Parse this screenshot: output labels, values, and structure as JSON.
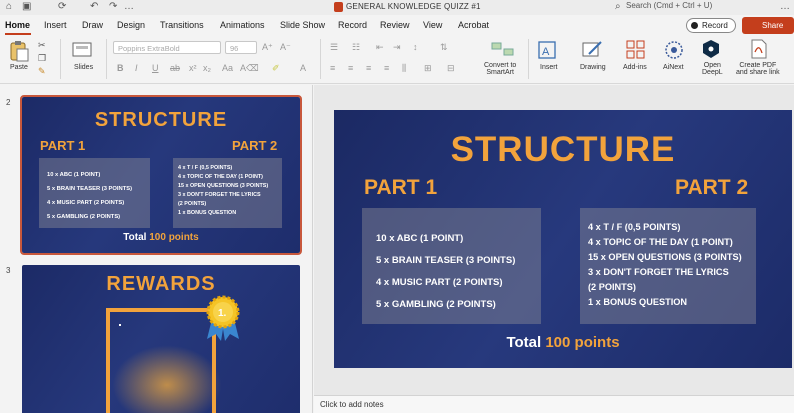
{
  "window": {
    "title": "GENERAL KNOWLEDGE QUIZZ #1",
    "search_placeholder": "Search (Cmd + Ctrl + U)"
  },
  "tabs": [
    "Home",
    "Insert",
    "Draw",
    "Design",
    "Transitions",
    "Animations",
    "Slide Show",
    "Record",
    "Review",
    "View",
    "Acrobat"
  ],
  "actions": {
    "record": "Record",
    "share": "Share"
  },
  "ribbon": {
    "paste": "Paste",
    "slides": "Slides",
    "font_name": "Poppins ExtraBold",
    "font_size": "96",
    "convert_smartart": [
      "Convert to",
      "SmartArt"
    ],
    "insert": "Insert",
    "drawing": "Drawing",
    "addins": "Add-ins",
    "ainext": "AiNext",
    "open_deepl": [
      "Open",
      "DeepL"
    ],
    "create_pdf": [
      "Create PDF",
      "and share link"
    ]
  },
  "thumbnails": {
    "slide2_number": "2",
    "slide3_number": "3",
    "slide3_title": "REWARDS",
    "medal_label": "1."
  },
  "slide": {
    "title": "STRUCTURE",
    "part1_title": "PART 1",
    "part2_title": "PART 2",
    "part1_items": [
      "10 x ABC (1 POINT)",
      "5 x BRAIN TEASER (3 POINTS)",
      "4 x MUSIC PART (2 POINTS)",
      "5 x GAMBLING (2 POINTS)"
    ],
    "part2_items": [
      "4 x T / F (0,5 POINTS)",
      "4 x TOPIC OF THE DAY (1 POINT)",
      "15 x OPEN QUESTIONS (3 POINTS)",
      "3 x DON'T FORGET THE LYRICS",
      "(2 POINTS)",
      "1 x BONUS QUESTION"
    ],
    "total_label": "Total",
    "total_value": "100 points"
  },
  "notes_placeholder": "Click to add notes",
  "colors": {
    "accent": "#f2a33c",
    "slide_bg": "#1f2e6e",
    "ribbon_accent": "#c43e1c"
  }
}
